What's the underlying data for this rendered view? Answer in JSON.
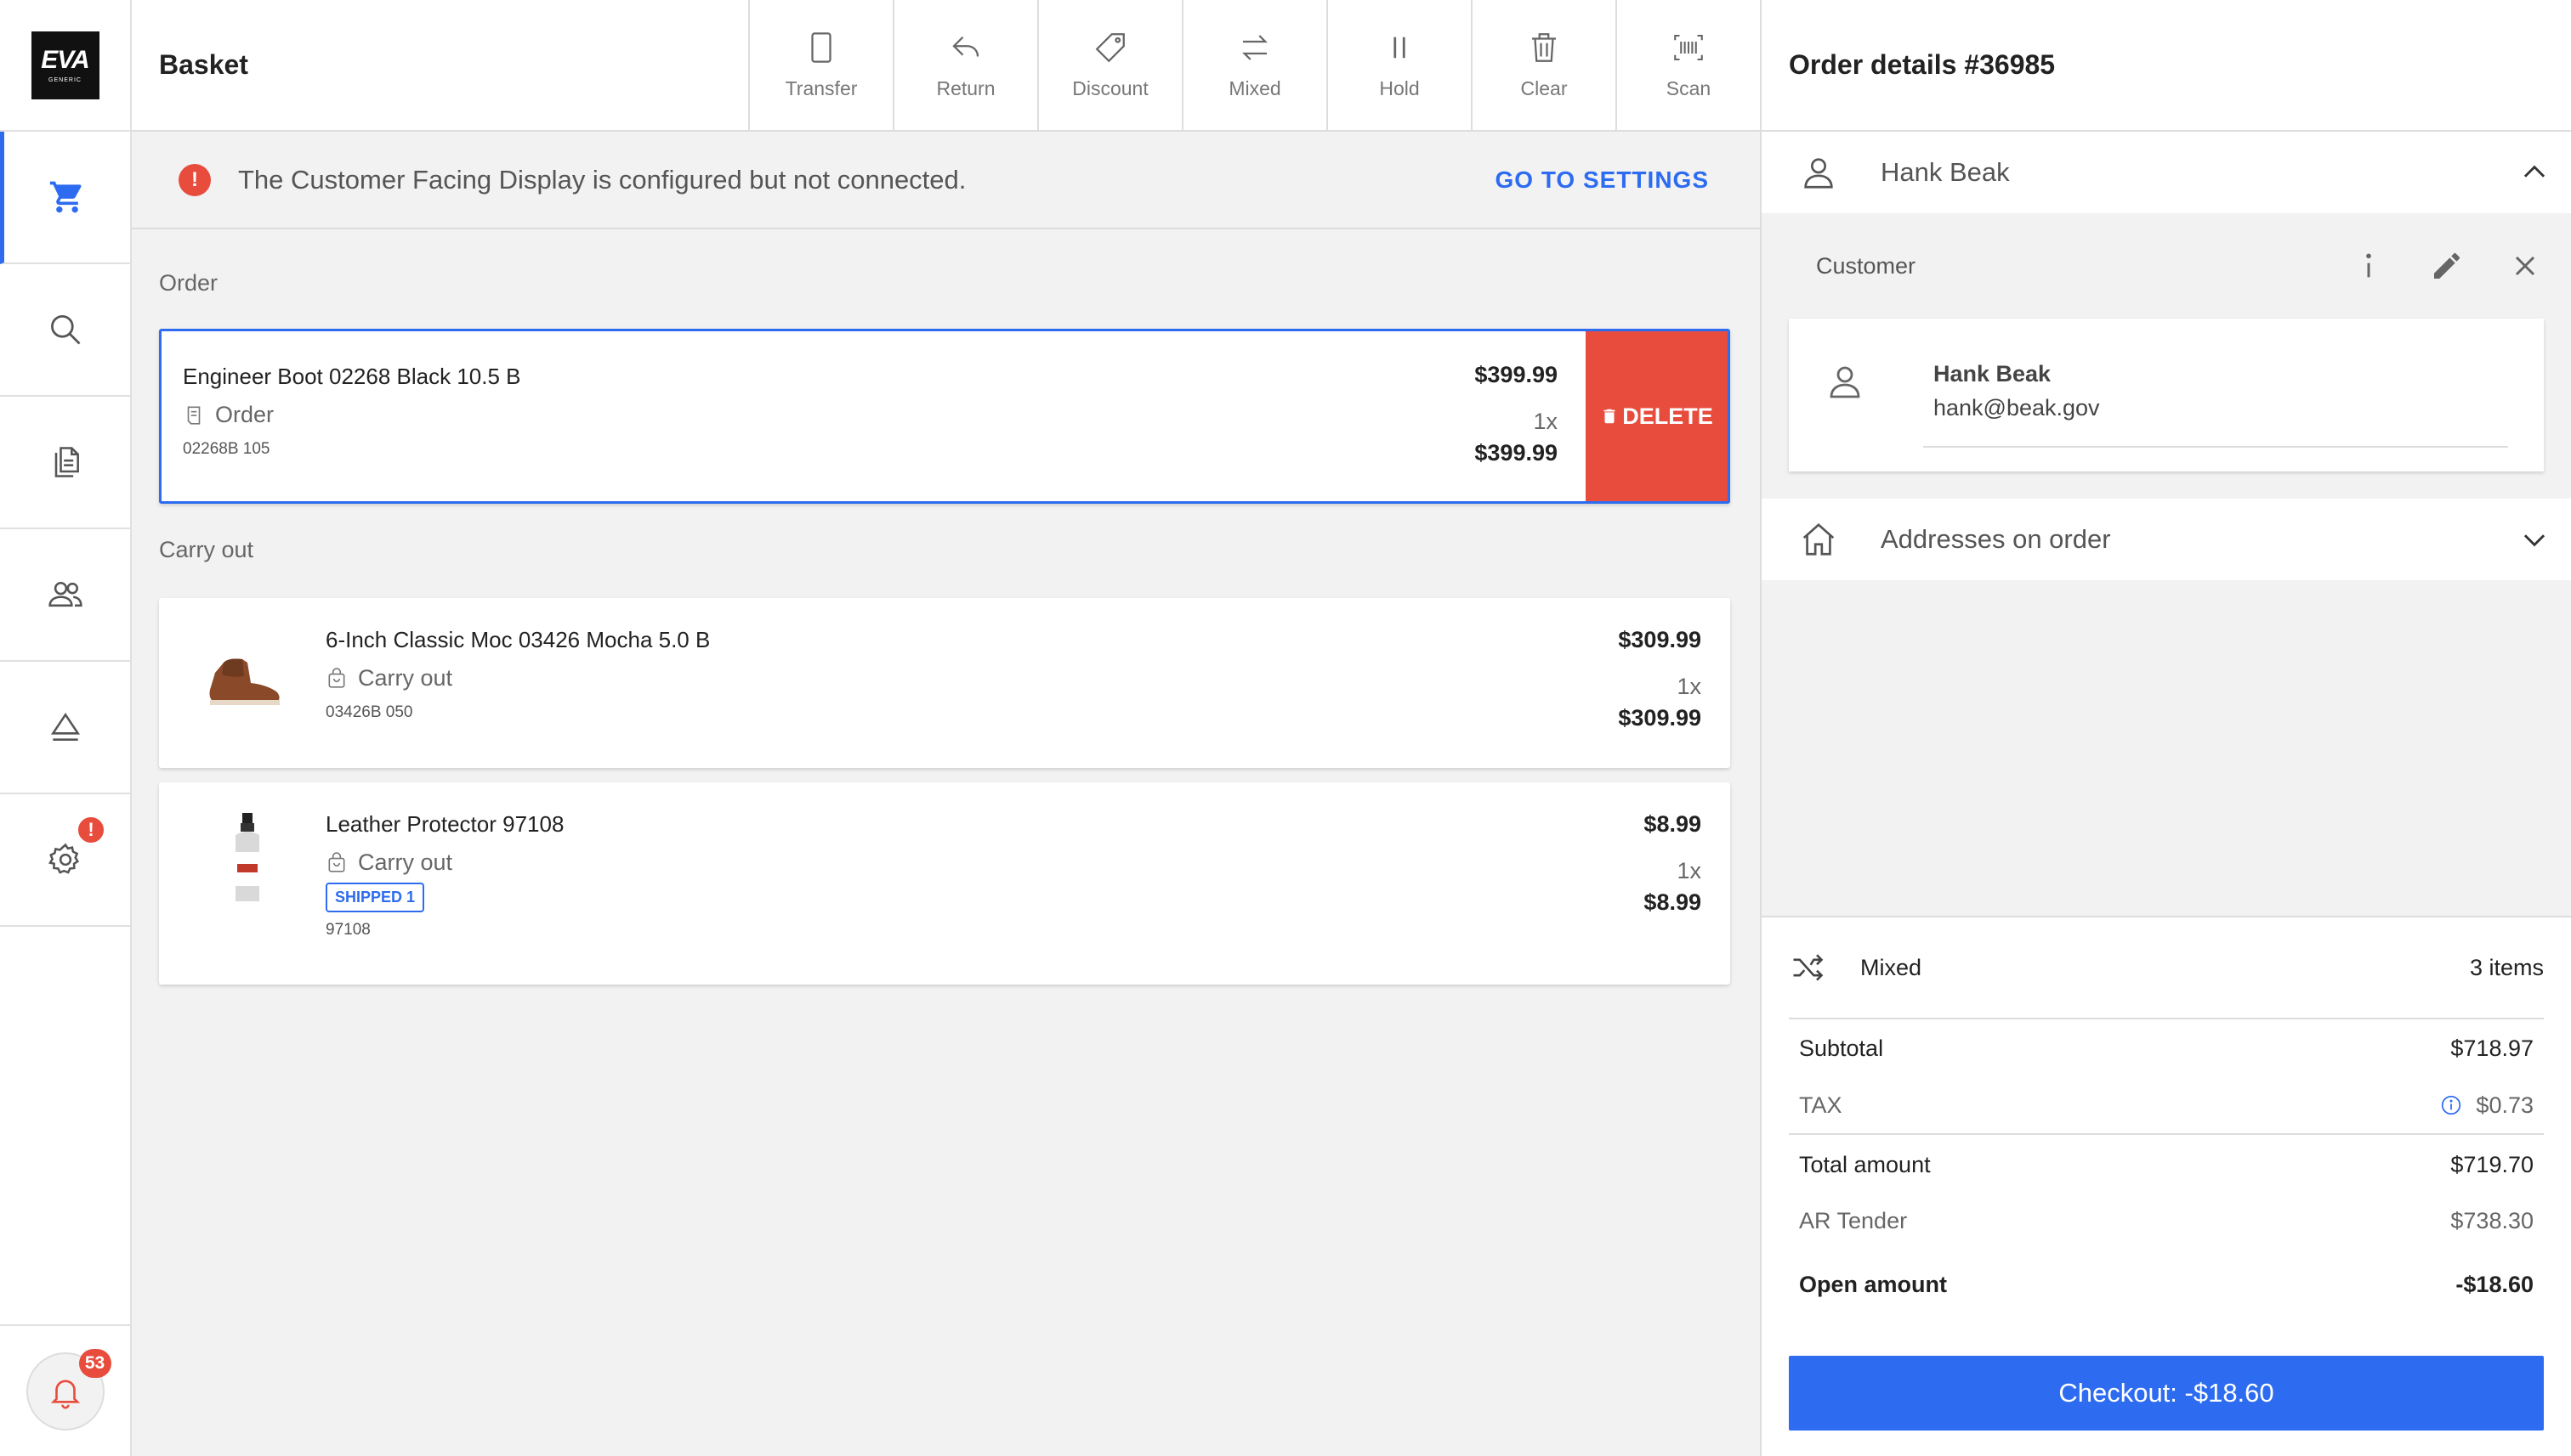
{
  "app": {
    "logo_text": "EVA",
    "logo_sub": "GENERIC"
  },
  "nav": {
    "items": [
      {
        "name": "cart-icon",
        "active": true
      },
      {
        "name": "search-icon"
      },
      {
        "name": "documents-icon"
      },
      {
        "name": "customers-icon"
      },
      {
        "name": "eject-icon"
      },
      {
        "name": "settings-icon",
        "badge": "!"
      }
    ],
    "notifications_count": "53"
  },
  "header": {
    "title": "Basket",
    "tools": [
      {
        "label": "Transfer",
        "icon": "tablet-icon"
      },
      {
        "label": "Return",
        "icon": "return-icon"
      },
      {
        "label": "Discount",
        "icon": "tag-icon"
      },
      {
        "label": "Mixed",
        "icon": "swap-icon"
      },
      {
        "label": "Hold",
        "icon": "pause-icon"
      },
      {
        "label": "Clear",
        "icon": "trash-icon"
      },
      {
        "label": "Scan",
        "icon": "barcode-icon"
      }
    ]
  },
  "alert": {
    "icon": "!",
    "text": "The Customer Facing Display is configured but not connected.",
    "action": "GO TO SETTINGS"
  },
  "sections": {
    "order_label": "Order",
    "carryout_label": "Carry out"
  },
  "order_items": [
    {
      "name": "Engineer Boot 02268 Black 10.5 B",
      "type": "Order",
      "sku": "02268B 105",
      "unit_price": "$399.99",
      "qty": "1x",
      "total": "$399.99",
      "delete_label": "DELETE"
    }
  ],
  "carryout_items": [
    {
      "name": "6-Inch Classic Moc 03426 Mocha 5.0 B",
      "type": "Carry out",
      "sku": "03426B 050",
      "unit_price": "$309.99",
      "qty": "1x",
      "total": "$309.99"
    },
    {
      "name": "Leather Protector 97108",
      "type": "Carry out",
      "badge": "SHIPPED 1",
      "sku": "97108",
      "unit_price": "$8.99",
      "qty": "1x",
      "total": "$8.99"
    }
  ],
  "details": {
    "title": "Order details #36985",
    "customer_name": "Hank Beak",
    "customer_section_label": "Customer",
    "customer_card": {
      "name": "Hank Beak",
      "email": "hank@beak.gov"
    },
    "addresses_label": "Addresses on order"
  },
  "summary": {
    "mode": "Mixed",
    "items_count": "3 items",
    "subtotal_label": "Subtotal",
    "subtotal": "$718.97",
    "tax_label": "TAX",
    "tax": "$0.73",
    "total_label": "Total amount",
    "total": "$719.70",
    "ar_label": "AR Tender",
    "ar": "$738.30",
    "open_label": "Open amount",
    "open": "-$18.60",
    "checkout_label": "Checkout: -$18.60"
  },
  "colors": {
    "accent": "#2d6cf0",
    "danger": "#e84c3d"
  }
}
